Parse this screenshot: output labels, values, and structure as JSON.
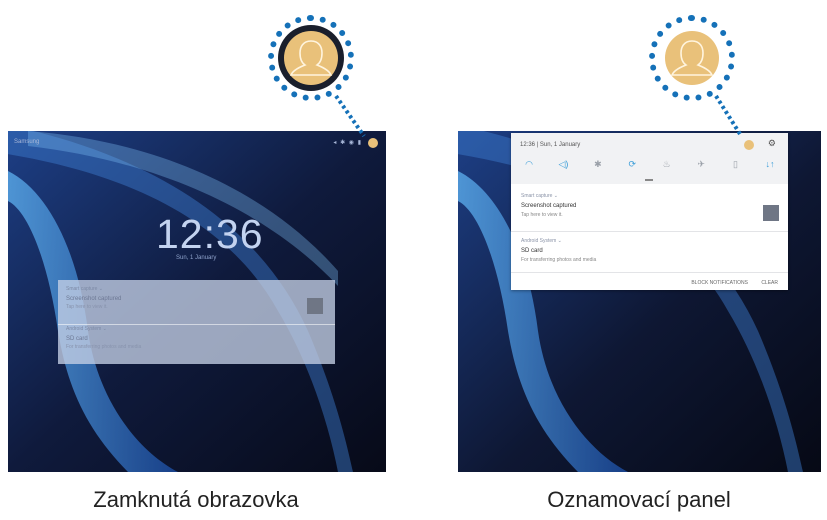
{
  "left_screen": {
    "status": {
      "carrier": "Samsung",
      "icons": "◂ ✱ ◉ ▮"
    },
    "clock": "12:36",
    "date": "Sun, 1 January",
    "card": {
      "n1_app": "Smart capture  ⌄",
      "n1_title": "Screenshot captured",
      "n1_sub": "Tap here to view it.",
      "n2_app": "Android System  ⌄",
      "n2_title": "SD card",
      "n2_sub": "For transferring photos and media"
    },
    "caption": "Zamknutá obrazovka"
  },
  "right_screen": {
    "time_date": "12:36 | Sun, 1 January",
    "gear": "⚙",
    "quick_settings": [
      "wifi-icon",
      "sound-icon",
      "bluetooth-icon",
      "auto-rotate-icon",
      "flashlight-icon",
      "airplane-icon",
      "power-saving-icon",
      "mobile-data-icon"
    ],
    "qs_glyphs": [
      "◠",
      "◁)",
      "✱",
      "⟳",
      "♨",
      "✈",
      "▯",
      "↓↑"
    ],
    "n1": {
      "app": "Smart capture  ⌄",
      "title": "Screenshot captured",
      "sub": "Tap here to view it."
    },
    "n2": {
      "app": "Android System  ⌄",
      "title": "SD card",
      "sub": "For transferring photos and media"
    },
    "actions": {
      "block": "BLOCK NOTIFICATIONS",
      "clear": "CLEAR"
    },
    "caption": "Oznamovací panel"
  },
  "colors": {
    "callout": "#1571b8",
    "avatar": "#e9c17a",
    "accent": "#3a9dd8"
  }
}
